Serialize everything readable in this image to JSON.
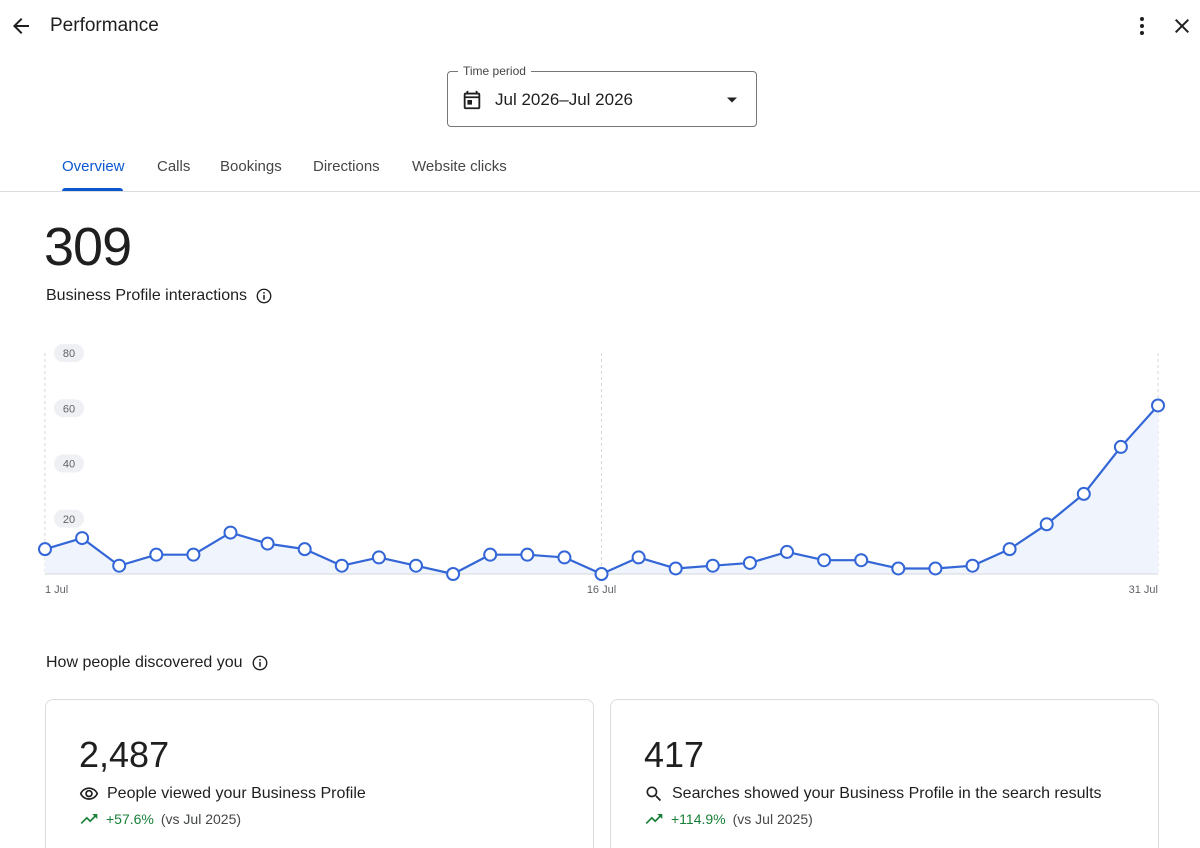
{
  "header": {
    "title": "Performance",
    "back_icon": "arrow-back-icon",
    "more_icon": "more-vert-icon",
    "close_icon": "close-icon"
  },
  "time_period": {
    "label": "Time period",
    "value": "Jul 2026–Jul 2026",
    "icon": "calendar-icon"
  },
  "tabs": [
    {
      "label": "Overview",
      "active": true
    },
    {
      "label": "Calls",
      "active": false
    },
    {
      "label": "Bookings",
      "active": false
    },
    {
      "label": "Directions",
      "active": false
    },
    {
      "label": "Website clicks",
      "active": false
    }
  ],
  "summary": {
    "total": "309",
    "label": "Business Profile interactions"
  },
  "chart_data": {
    "type": "area",
    "x_tick_labels": [
      "1 Jul",
      "16 Jul",
      "31 Jul"
    ],
    "y_ticks": [
      20,
      40,
      60,
      80
    ],
    "ylim": [
      0,
      80
    ],
    "x": [
      1,
      2,
      3,
      4,
      5,
      6,
      7,
      8,
      9,
      10,
      11,
      12,
      13,
      14,
      15,
      16,
      17,
      18,
      19,
      20,
      21,
      22,
      23,
      24,
      25,
      26,
      27,
      28,
      29,
      30,
      31
    ],
    "values": [
      9,
      13,
      3,
      7,
      7,
      15,
      11,
      9,
      3,
      6,
      3,
      0,
      7,
      7,
      6,
      0,
      6,
      2,
      3,
      4,
      8,
      5,
      5,
      2,
      2,
      3,
      9,
      18,
      29,
      46,
      61
    ],
    "color": "#3366d6",
    "fill": "#f0f4fd",
    "grid": "vertical dashed at 1 Jul, 16 Jul, 31 Jul"
  },
  "discovery": {
    "title": "How people discovered you",
    "cards": [
      {
        "number": "2,487",
        "description": "People viewed your Business Profile",
        "icon": "eye-icon",
        "change": "+57.6%",
        "comparison": "(vs Jul 2025)"
      },
      {
        "number": "417",
        "description": "Searches showed your Business Profile in the search results",
        "icon": "search-icon",
        "change": "+114.9%",
        "comparison": "(vs Jul 2025)"
      }
    ]
  },
  "colors": {
    "accent": "#0b57d0",
    "positive": "#188038"
  }
}
